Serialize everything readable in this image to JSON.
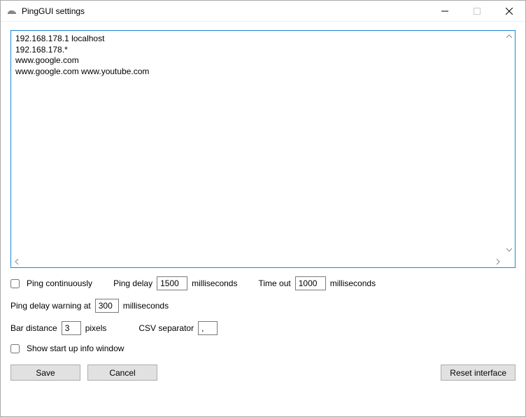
{
  "window": {
    "title": "PingGUI settings"
  },
  "hosts_text": "192.168.178.1 localhost\n192.168.178.*\nwww.google.com\nwww.google.com www.youtube.com",
  "labels": {
    "ping_continuously": "Ping continuously",
    "ping_delay": "Ping delay",
    "milliseconds": "milliseconds",
    "time_out": "Time out",
    "ping_delay_warning_at": "Ping delay warning at",
    "bar_distance": "Bar distance",
    "pixels": "pixels",
    "csv_separator": "CSV separator",
    "show_startup_info": "Show start up info window"
  },
  "values": {
    "ping_continuously": false,
    "ping_delay": "1500",
    "time_out": "1000",
    "ping_delay_warning": "300",
    "bar_distance": "3",
    "csv_separator": ",",
    "show_startup_info": false
  },
  "buttons": {
    "save": "Save",
    "cancel": "Cancel",
    "reset_interface": "Reset interface"
  }
}
